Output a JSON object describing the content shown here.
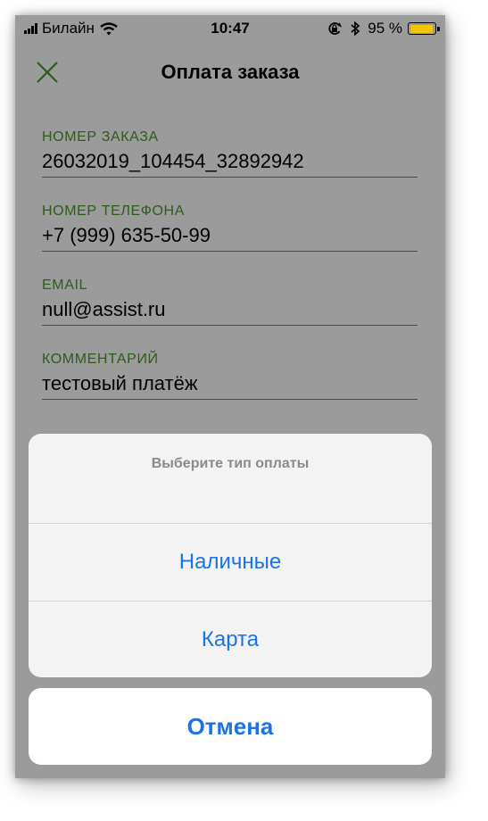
{
  "status_bar": {
    "carrier": "Билайн",
    "time": "10:47",
    "battery": "95 %",
    "battery_level": 0.95,
    "battery_color": "#f5c400"
  },
  "nav": {
    "title": "Оплата заказа",
    "close_icon": "close-icon",
    "accent": "#2d5b18"
  },
  "form": {
    "fields": [
      {
        "label": "НОМЕР ЗАКАЗА",
        "value": "26032019_104454_32892942"
      },
      {
        "label": "НОМЕР ТЕЛЕФОНА",
        "value": "+7 (999) 635-50-99"
      },
      {
        "label": "EMAIL",
        "value": "null@assist.ru"
      },
      {
        "label": "КОММЕНТАРИЙ",
        "value": "тестовый платёж"
      }
    ]
  },
  "action_sheet": {
    "title": "Выберите тип оплаты",
    "options": [
      "Наличные",
      "Карта"
    ],
    "cancel": "Отмена",
    "button_color": "#1a74e8"
  }
}
